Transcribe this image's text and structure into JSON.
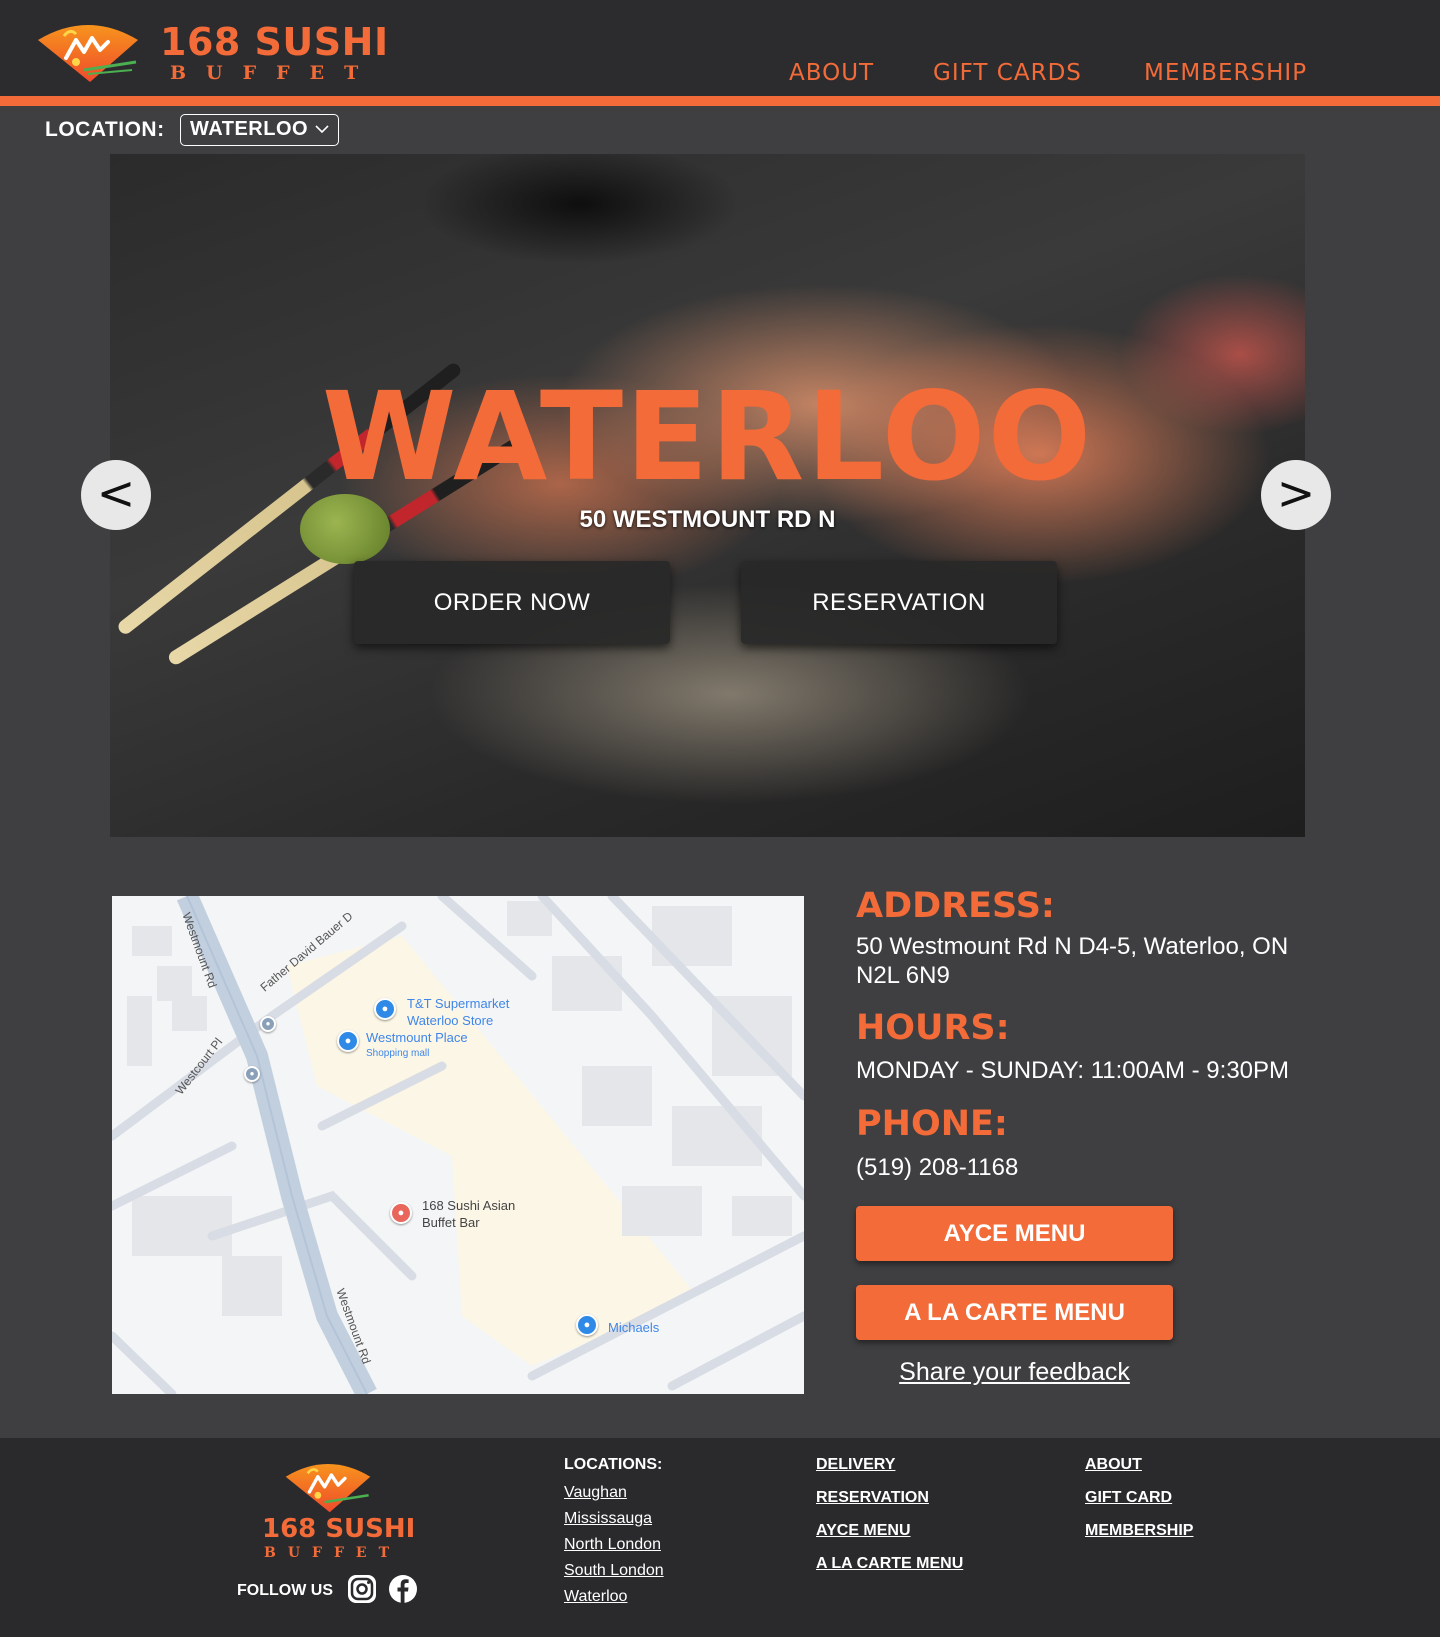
{
  "brand": {
    "name": "168 SUSHI",
    "subtitle": "BUFFET",
    "accent_color": "#f26b38"
  },
  "nav": [
    {
      "label": "ABOUT"
    },
    {
      "label": "GIFT CARDS"
    },
    {
      "label": "MEMBERSHIP"
    }
  ],
  "location_selector": {
    "label": "LOCATION:",
    "selected": "WATERLOO"
  },
  "hero": {
    "title": "WATERLOO",
    "subtitle": "50 WESTMOUNT RD N",
    "order_label": "ORDER NOW",
    "reservation_label": "RESERVATION",
    "prev_label": "<",
    "next_label": ">"
  },
  "map": {
    "places": [
      {
        "name": "T&T Supermarket",
        "detail": "Waterloo Store"
      },
      {
        "name": "Westmount Place",
        "detail": "Shopping mall"
      },
      {
        "name": "168 Sushi Asian",
        "detail": "Buffet Bar"
      },
      {
        "name": "Michaels",
        "detail": ""
      }
    ],
    "roads": [
      "Westmount Rd",
      "Father David Bauer D",
      "Westcourt Pl",
      "Westmount Rd"
    ]
  },
  "info": {
    "address_heading": "ADDRESS:",
    "address_text": "50 Westmount Rd N D4-5, Waterloo, ON N2L 6N9",
    "hours_heading": "HOURS:",
    "hours_text": "MONDAY - SUNDAY: 11:00AM - 9:30PM",
    "phone_heading": "PHONE:",
    "phone_text": "(519) 208-1168",
    "ayce_label": "AYCE MENU",
    "alacarte_label": "A LA CARTE MENU",
    "feedback_label": "Share your feedback"
  },
  "footer": {
    "brand_name": "168 SUSHI",
    "brand_sub": "BUFFET",
    "follow_label": "FOLLOW US",
    "social_icons": [
      "instagram-icon",
      "facebook-icon"
    ],
    "locations_title": "LOCATIONS:",
    "locations": [
      "Vaughan",
      "Mississauga",
      "North London",
      "South London",
      "Waterloo"
    ],
    "col2": [
      "DELIVERY",
      "RESERVATION",
      "AYCE MENU",
      "A LA CARTE MENU"
    ],
    "col3": [
      "ABOUT",
      "GIFT CARD",
      "MEMBERSHIP"
    ]
  }
}
